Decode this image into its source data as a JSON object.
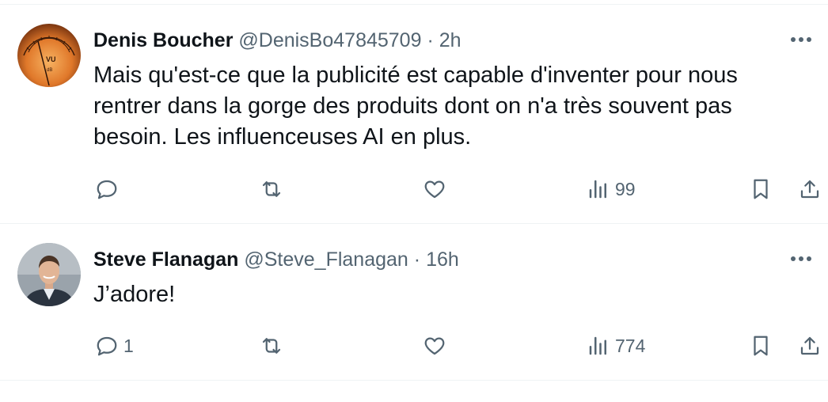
{
  "tweets": [
    {
      "display_name": "Denis Boucher",
      "handle": "@DenisBo47845709",
      "separator": "·",
      "time": "2h",
      "text": "Mais qu'est-ce que la publicité est capable d'inventer pour nous rentrer dans la gorge des produits dont on n'a très souvent pas besoin. Les influenceuses AI en plus.",
      "avatar_icon": "vu-meter-avatar",
      "replies": "",
      "views": "99"
    },
    {
      "display_name": "Steve Flanagan",
      "handle": "@Steve_Flanagan",
      "separator": "·",
      "time": "16h",
      "text": "J’adore!",
      "avatar_icon": "person-avatar",
      "replies": "1",
      "views": "774"
    }
  ],
  "colors": {
    "text_primary": "#0f1419",
    "text_secondary": "#536471",
    "divider": "#eff3f4",
    "vu_orange": "#e0782a"
  }
}
